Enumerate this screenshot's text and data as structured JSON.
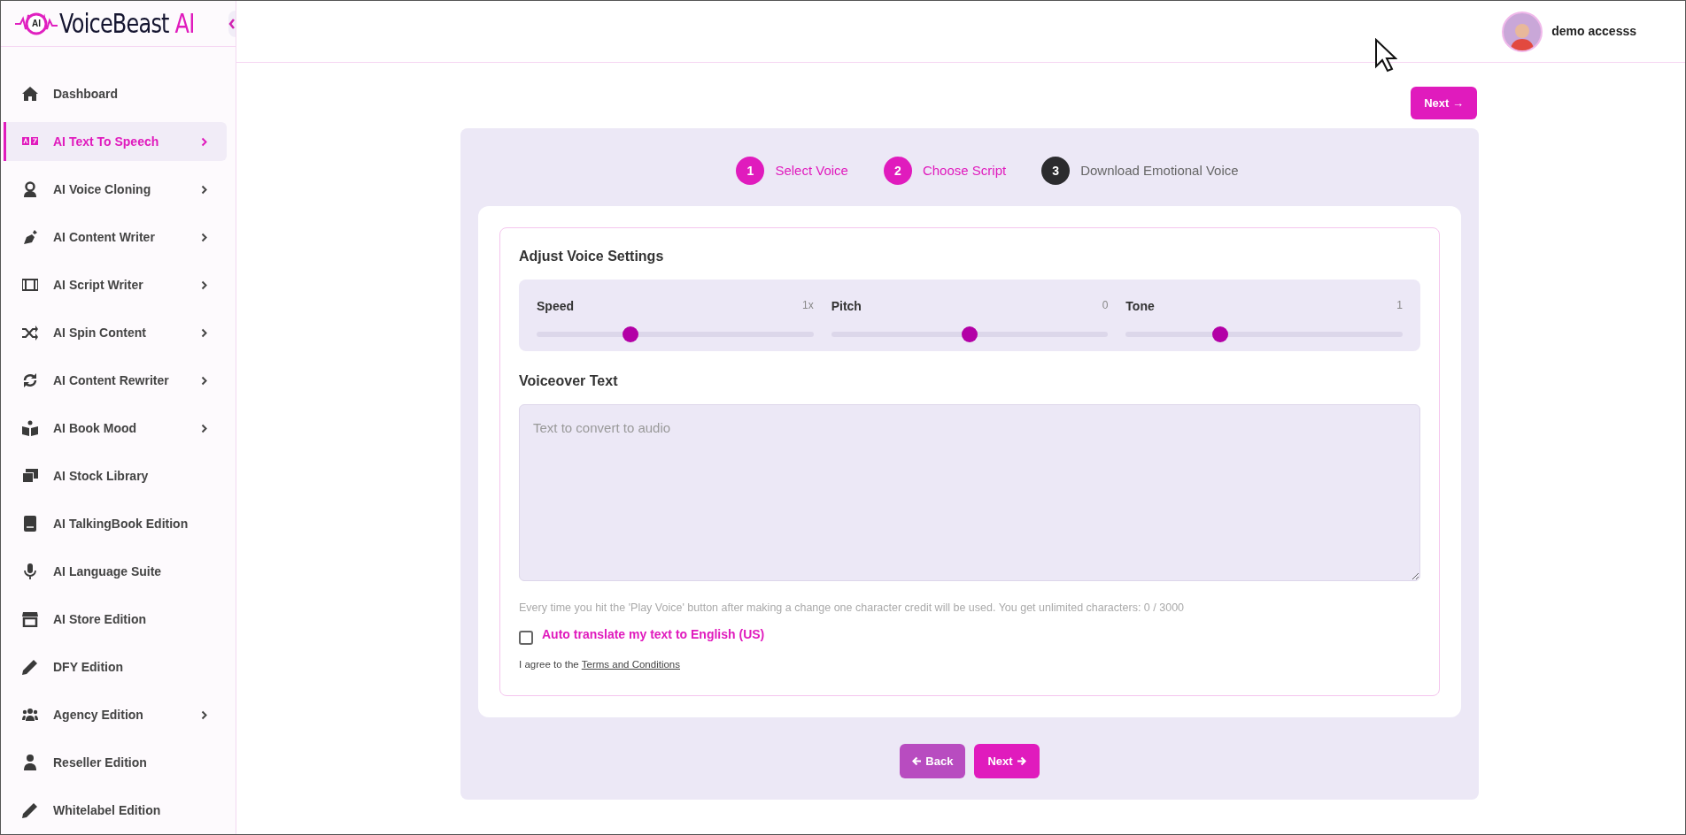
{
  "logo": {
    "badge": "AI",
    "name": "VoiceBeast",
    "suffix": "AI"
  },
  "sidebar": {
    "items": [
      {
        "label": "Dashboard",
        "selected": false,
        "submenu": false
      },
      {
        "label": "AI Text To Speech",
        "selected": true,
        "submenu": true
      },
      {
        "label": "AI Voice Cloning",
        "selected": false,
        "submenu": true
      },
      {
        "label": "AI Content Writer",
        "selected": false,
        "submenu": true
      },
      {
        "label": "AI Script Writer",
        "selected": false,
        "submenu": true
      },
      {
        "label": "AI Spin Content",
        "selected": false,
        "submenu": true
      },
      {
        "label": "AI Content Rewriter",
        "selected": false,
        "submenu": true
      },
      {
        "label": "AI Book Mood",
        "selected": false,
        "submenu": true
      },
      {
        "label": "AI Stock Library",
        "selected": false,
        "submenu": false
      },
      {
        "label": "AI TalkingBook Edition",
        "selected": false,
        "submenu": false
      },
      {
        "label": "AI Language Suite",
        "selected": false,
        "submenu": false
      },
      {
        "label": "AI Store Edition",
        "selected": false,
        "submenu": false
      },
      {
        "label": "DFY Edition",
        "selected": false,
        "submenu": false
      },
      {
        "label": "Agency Edition",
        "selected": false,
        "submenu": true
      },
      {
        "label": "Reseller Edition",
        "selected": false,
        "submenu": false
      },
      {
        "label": "Whitelabel Edition",
        "selected": false,
        "submenu": false
      }
    ]
  },
  "user": {
    "name": "demo accesss"
  },
  "top_next": "Next →",
  "steps": [
    {
      "number": "1",
      "label": "Select Voice",
      "completed": true
    },
    {
      "number": "2",
      "label": "Choose Script",
      "completed": true
    },
    {
      "number": "3",
      "label": "Download Emotional Voice",
      "completed": false
    }
  ],
  "settings": {
    "title": "Adjust Voice Settings",
    "sliders": [
      {
        "label": "Speed",
        "reading": "1x",
        "level": 0.34
      },
      {
        "label": "Pitch",
        "reading": "0",
        "level": 0.5
      },
      {
        "label": "Tone",
        "reading": "1",
        "level": 0.34
      }
    ]
  },
  "voiceover": {
    "title": "Voiceover Text",
    "placeholder": "Text to convert to audio",
    "hint": "Every time you hit the 'Play Voice' button after making a change one character credit will be used. You get unlimited characters: 0 / 3000"
  },
  "auto_translate": {
    "label": "Auto translate my text to English (US)",
    "checked": false
  },
  "agree": {
    "text": "I agree to the",
    "link": "Terms and Conditions"
  },
  "buttons": {
    "back": "Back",
    "next": "Next"
  }
}
